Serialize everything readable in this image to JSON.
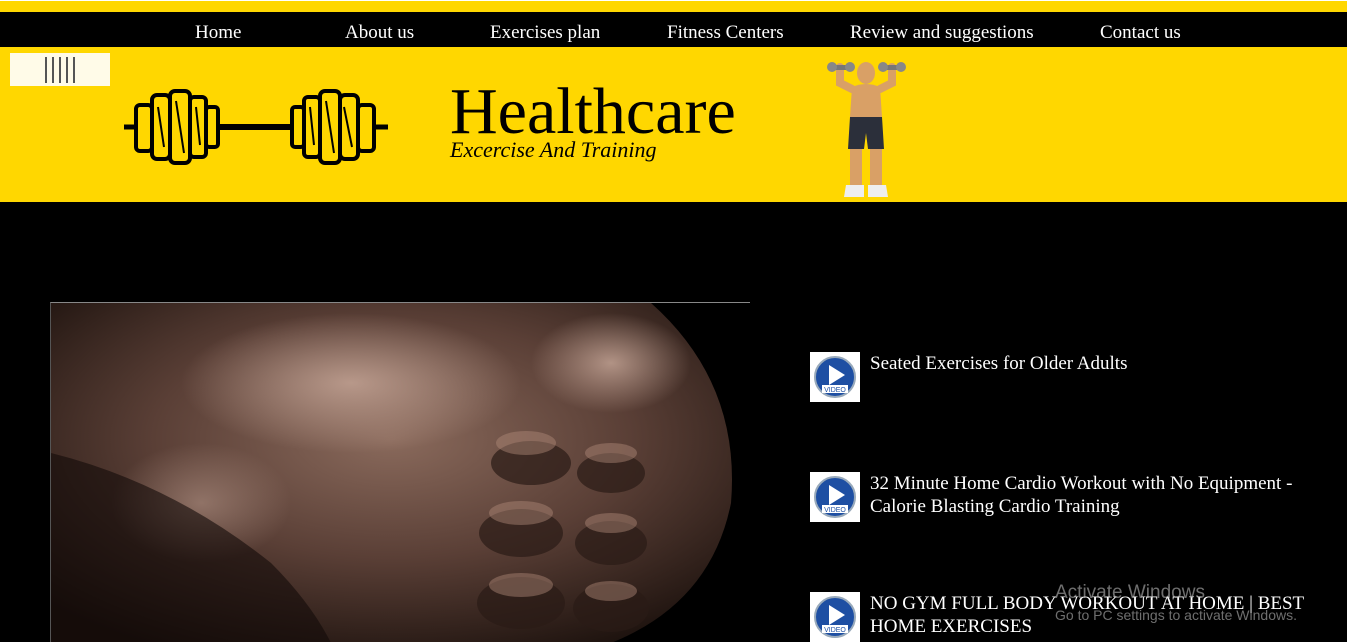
{
  "nav": {
    "items": [
      "Home",
      "About us",
      "Exercises plan",
      "Fitness Centers",
      "Review and suggestions",
      "Contact us"
    ]
  },
  "brand": {
    "title": "Healthcare",
    "subtitle": "Excercise And Training"
  },
  "icons": {
    "menu": "menu-bars-icon",
    "logo": "dumbbell-icon",
    "athlete": "bodybuilder-illustration",
    "video": "video-play-icon"
  },
  "videos": [
    {
      "title": "Seated Exercises for Older Adults",
      "badge": "VIDEO"
    },
    {
      "title": "32 Minute Home Cardio Workout with No Equipment - Calorie Blasting Cardio Training",
      "badge": "VIDEO"
    },
    {
      "title": "NO GYM FULL BODY WORKOUT AT HOME | BEST HOME EXERCISES",
      "badge": "VIDEO"
    }
  ],
  "watermark": {
    "line1": "Activate Windows",
    "line2": "Go to PC settings to activate Windows."
  },
  "colors": {
    "accent": "#ffd700",
    "background": "#000000"
  }
}
